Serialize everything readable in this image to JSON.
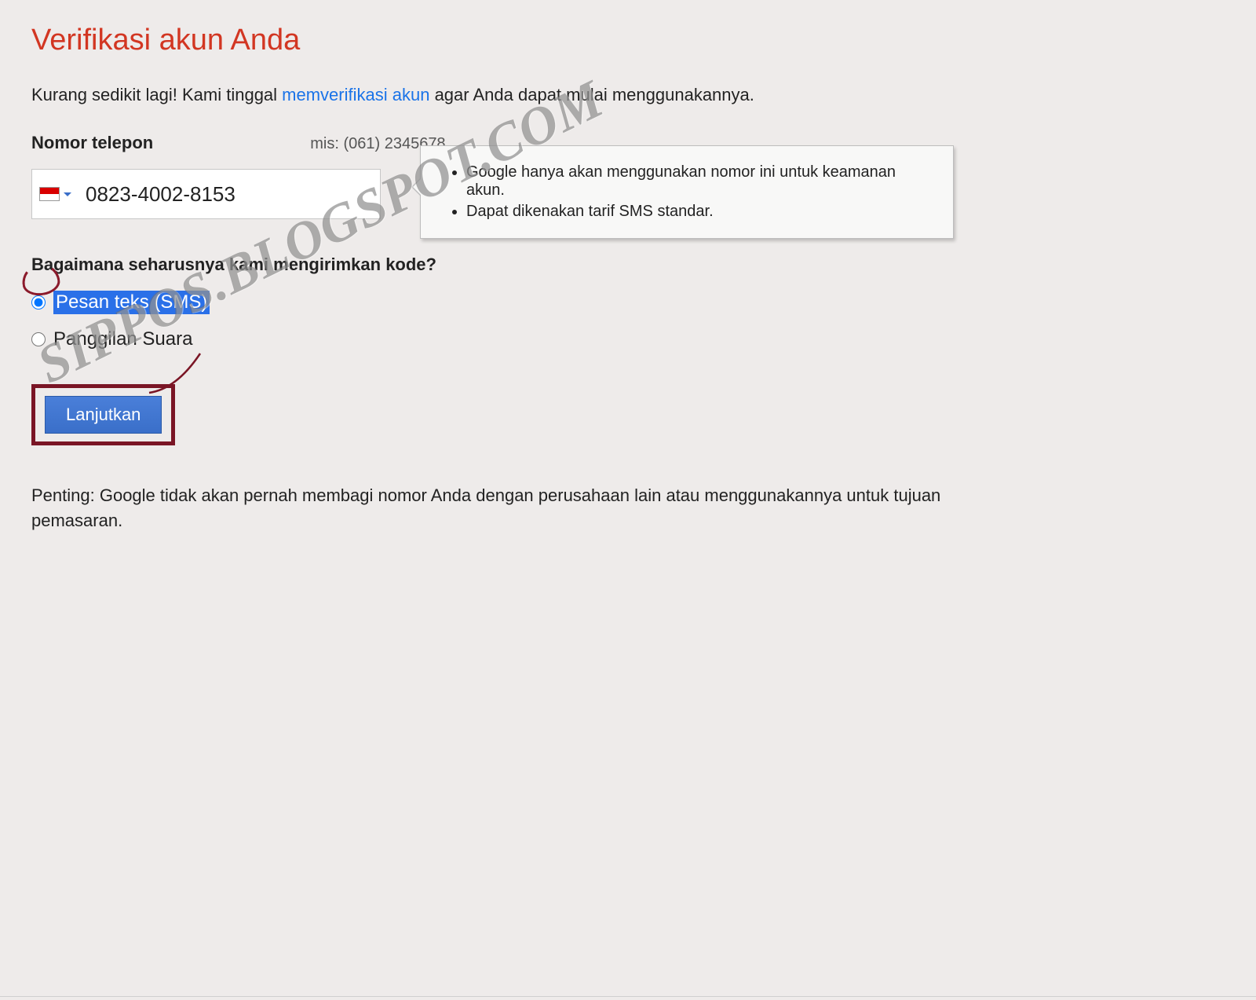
{
  "title": "Verifikasi akun Anda",
  "intro": {
    "before": "Kurang sedikit lagi! Kami tinggal ",
    "link": "memverifikasi akun",
    "after": " agar Anda dapat mulai menggunakannya."
  },
  "phone": {
    "label": "Nomor telepon",
    "hint": "mis: (061) 2345678",
    "value": "0823-4002-8153"
  },
  "tooltip": {
    "item1": "Google hanya akan menggunakan nomor ini untuk keamanan akun.",
    "item2": "Dapat dikenakan tarif SMS standar."
  },
  "question": "Bagaimana seharusnya kami mengirimkan kode?",
  "options": {
    "sms": "Pesan teks (SMS)",
    "voice": "Panggilan Suara"
  },
  "button": "Lanjutkan",
  "important": "Penting: Google tidak akan pernah membagi nomor Anda dengan perusahaan lain atau menggunakannya untuk tujuan pemasaran.",
  "watermark": "SIPPOS.BLOGSPOT.COM"
}
